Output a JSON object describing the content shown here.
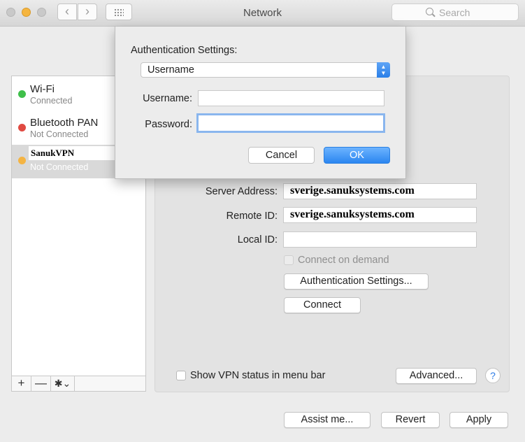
{
  "window": {
    "title": "Network"
  },
  "toolbar": {
    "back_icon": "‹",
    "forward_icon": "›",
    "search_placeholder": "Search"
  },
  "sidebar": {
    "services": [
      {
        "name": "Wi-Fi",
        "status": "Connected",
        "color": "#3fbf4a"
      },
      {
        "name": "Bluetooth PAN",
        "status": "Not Connected",
        "color": "#e04a42"
      },
      {
        "name": "SanukVPN",
        "status": "Not Connected",
        "color": "#f4b443"
      }
    ],
    "add_label": "+",
    "remove_label": "—",
    "gear_label": "✱⌄"
  },
  "detail": {
    "server_address_label": "Server Address:",
    "server_address_value": "sverige.sanuksystems.com",
    "remote_id_label": "Remote ID:",
    "remote_id_value": "sverige.sanuksystems.com",
    "local_id_label": "Local ID:",
    "local_id_value": "",
    "connect_on_demand_label": "Connect on demand",
    "auth_settings_button": "Authentication Settings...",
    "connect_button": "Connect",
    "show_vpn_status_label": "Show VPN status in menu bar",
    "advanced_button": "Advanced...",
    "help_label": "?"
  },
  "footer": {
    "assist_button": "Assist me...",
    "revert_button": "Revert",
    "apply_button": "Apply"
  },
  "sheet": {
    "title": "Authentication Settings:",
    "method_value": "Username",
    "username_label": "Username:",
    "username_value": "",
    "password_label": "Password:",
    "password_value": "",
    "cancel_button": "Cancel",
    "ok_button": "OK"
  }
}
